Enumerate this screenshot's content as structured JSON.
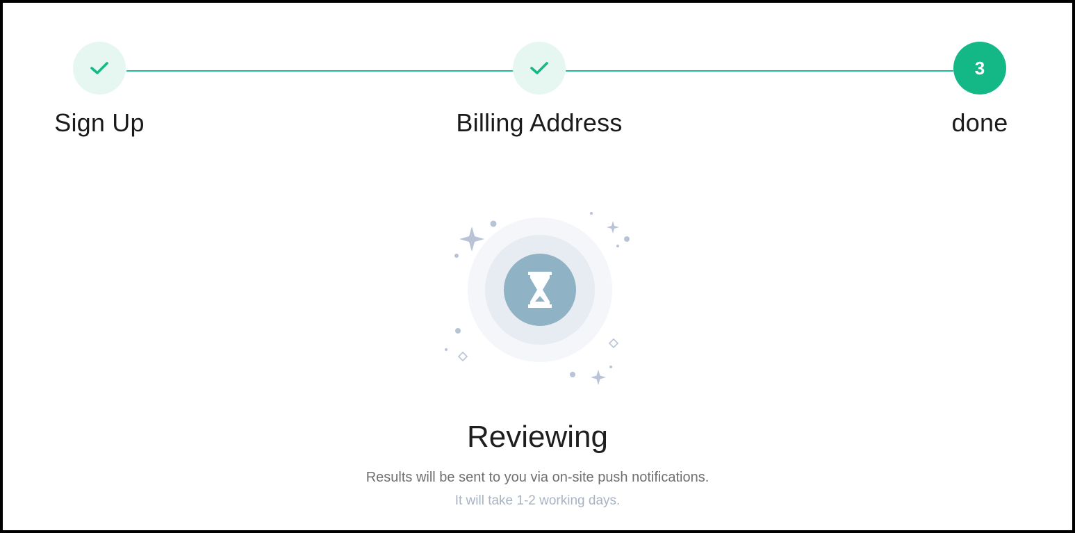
{
  "steps": [
    {
      "label": "Sign Up",
      "status": "completed",
      "icon": "check-icon"
    },
    {
      "label": "Billing Address",
      "status": "completed",
      "icon": "check-icon"
    },
    {
      "label": "done",
      "status": "active",
      "number": "3"
    }
  ],
  "status": {
    "title": "Reviewing",
    "message": "Results will be sent to you via on-site push notifications.",
    "note": "It will take 1-2 working days.",
    "icon": "hourglass-icon"
  },
  "colors": {
    "accent": "#14b886",
    "line": "#1fc095",
    "completed_bg": "#e6f7f1",
    "hourglass_bg": "#8fb2c4",
    "sparkle": "#b8c3d6"
  }
}
